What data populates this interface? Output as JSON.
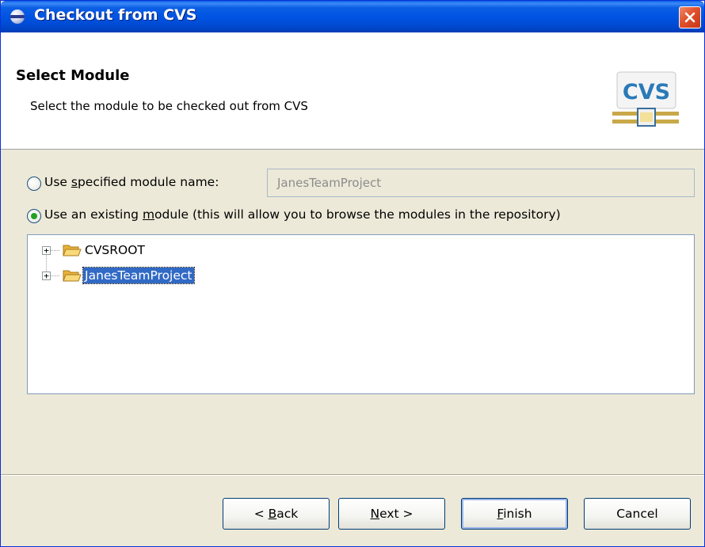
{
  "window": {
    "title": "Checkout from CVS"
  },
  "banner": {
    "title": "Select Module",
    "description": "Select the module to be checked out from CVS",
    "logo_text": "CVS"
  },
  "options": {
    "specified": {
      "label_pre": "Use ",
      "label_mnemonic": "s",
      "label_post": "pecified module name:",
      "selected": false,
      "input_value": "JanesTeamProject"
    },
    "existing": {
      "label_pre": "Use an existing ",
      "label_mnemonic": "m",
      "label_post": "odule (this will allow you to browse the modules in the repository)",
      "selected": true
    }
  },
  "tree": {
    "items": [
      {
        "label": "CVSROOT",
        "expander": "+",
        "selected": false
      },
      {
        "label": "JanesTeamProject",
        "expander": "+",
        "selected": true
      }
    ]
  },
  "buttons": {
    "back": {
      "pre": "< ",
      "mnemonic": "B",
      "post": "ack"
    },
    "next": {
      "pre": "",
      "mnemonic": "N",
      "post": "ext >"
    },
    "finish": {
      "pre": "",
      "mnemonic": "F",
      "post": "inish"
    },
    "cancel": {
      "label": "Cancel"
    }
  },
  "icons": {
    "app": "eclipse-icon",
    "close": "close-icon",
    "folder": "folder-open-icon",
    "logo": "cvs-logo-icon"
  },
  "colors": {
    "titlebar": "#0054e3",
    "selection": "#316ac5",
    "radio_dot": "#21a121",
    "close": "#e0502a",
    "folder": "#f4c04a"
  }
}
